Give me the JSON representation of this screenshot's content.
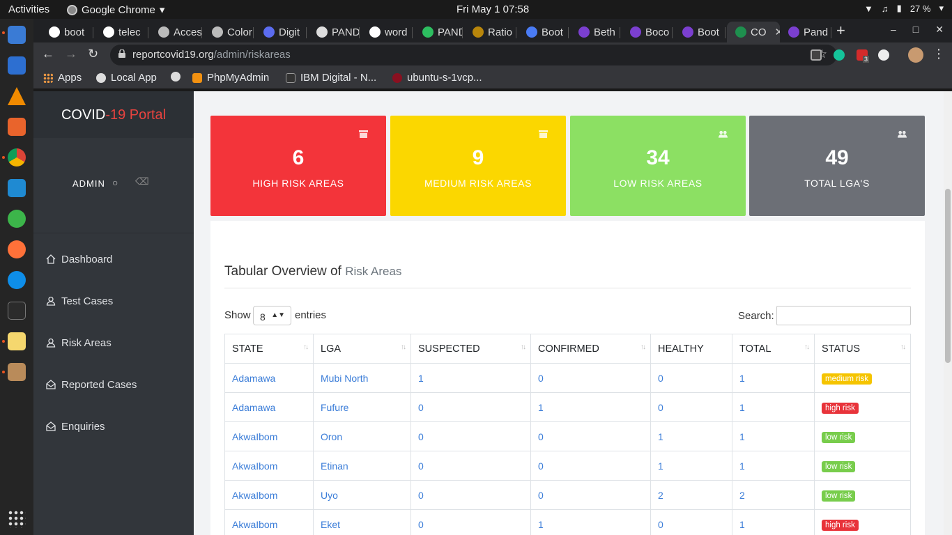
{
  "desktop": {
    "activities": "Activities",
    "app_name": "Google Chrome",
    "clock": "Fri May 1  07:58",
    "battery": "27 %"
  },
  "browser": {
    "tabs": [
      {
        "label": "boot",
        "color": "#fff"
      },
      {
        "label": "telec",
        "color": "#fff"
      },
      {
        "label": "Acces",
        "color": "#bbb"
      },
      {
        "label": "Color",
        "color": "#bbb"
      },
      {
        "label": "Digit",
        "color": "#5b6cf0"
      },
      {
        "label": "PAND",
        "color": "#ddd"
      },
      {
        "label": "word",
        "color": "#fff"
      },
      {
        "label": "PAND",
        "color": "#2dbe60"
      },
      {
        "label": "Ratio",
        "color": "#b8860b"
      },
      {
        "label": "Boot",
        "color": "#4a7cf5"
      },
      {
        "label": "Beth",
        "color": "#7b3fd0"
      },
      {
        "label": "Boco",
        "color": "#7b3fd0"
      },
      {
        "label": "Boot",
        "color": "#7b3fd0"
      },
      {
        "label": "CO",
        "color": "#1e8f4e"
      },
      {
        "label": "Pand",
        "color": "#7b3fd0"
      }
    ],
    "url_host": "reportcovid19.org",
    "url_path": "/admin/riskareas",
    "bookmarks": [
      "Apps",
      "Local App",
      "PhpMyAdmin",
      "IBM Digital - N...",
      "ubuntu-s-1vcp..."
    ],
    "ext_badge": "3"
  },
  "sidebar": {
    "brand_a": "COVID",
    "brand_b": "-19 Portal",
    "user": "ADMIN",
    "nav": [
      "Dashboard",
      "Test Cases",
      "Risk Areas",
      "Reported Cases",
      "Enquiries"
    ]
  },
  "stats": [
    {
      "value": "6",
      "label": "HIGH RISK AREAS",
      "color": "#f3343a"
    },
    {
      "value": "9",
      "label": "MEDIUM RISK AREAS",
      "color": "#fbd700"
    },
    {
      "value": "34",
      "label": "LOW RISK AREAS",
      "color": "#8ce063"
    },
    {
      "value": "49",
      "label": "TOTAL LGA'S",
      "color": "#6c6f76"
    }
  ],
  "panel": {
    "title": "Tabular Overview of",
    "title_sub": "Risk Areas",
    "show": "Show",
    "page_size": "8",
    "entries": "entries",
    "search": "Search:"
  },
  "table": {
    "headers": [
      "STATE",
      "LGA",
      "SUSPECTED",
      "CONFIRMED",
      "HEALTHY",
      "TOTAL",
      "STATUS"
    ],
    "rows": [
      [
        "Adamawa",
        "Mubi North",
        "1",
        "0",
        "0",
        "1",
        "medium risk"
      ],
      [
        "Adamawa",
        "Fufure",
        "0",
        "1",
        "0",
        "1",
        "high risk"
      ],
      [
        "AkwaIbom",
        "Oron",
        "0",
        "0",
        "1",
        "1",
        "low risk"
      ],
      [
        "AkwaIbom",
        "Etinan",
        "0",
        "0",
        "1",
        "1",
        "low risk"
      ],
      [
        "AkwaIbom",
        "Uyo",
        "0",
        "0",
        "2",
        "2",
        "low risk"
      ],
      [
        "AkwaIbom",
        "Eket",
        "0",
        "1",
        "0",
        "1",
        "high risk"
      ]
    ],
    "status_colors": {
      "medium risk": "#f5c400",
      "high risk": "#e8333a",
      "low risk": "#78cd4c"
    }
  }
}
